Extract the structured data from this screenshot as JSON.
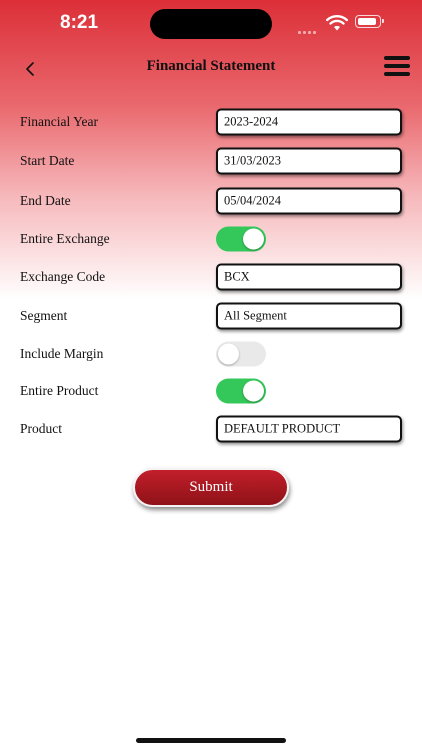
{
  "status_bar": {
    "time": "8:21"
  },
  "header": {
    "title": "Financial Statement"
  },
  "form": {
    "financial_year": {
      "label": "Financial Year",
      "value": "2023-2024"
    },
    "start_date": {
      "label": "Start Date",
      "value": "31/03/2023"
    },
    "end_date": {
      "label": "End Date",
      "value": "05/04/2024"
    },
    "entire_exchange": {
      "label": "Entire Exchange",
      "on": true
    },
    "exchange_code": {
      "label": "Exchange Code",
      "value": "BCX"
    },
    "segment": {
      "label": "Segment",
      "value": "All Segment"
    },
    "include_margin": {
      "label": "Include Margin",
      "on": false
    },
    "entire_product": {
      "label": "Entire Product",
      "on": true
    },
    "product": {
      "label": "Product",
      "value": "DEFAULT PRODUCT"
    }
  },
  "submit_label": "Submit",
  "colors": {
    "accent_red": "#c21f2a",
    "toggle_on": "#34c759",
    "toggle_off": "#e9e9ea"
  },
  "icons": {
    "back": "chevron-left-icon",
    "menu": "hamburger-menu-icon",
    "wifi": "wifi-icon",
    "battery": "battery-icon",
    "signal": "signal-icon"
  }
}
